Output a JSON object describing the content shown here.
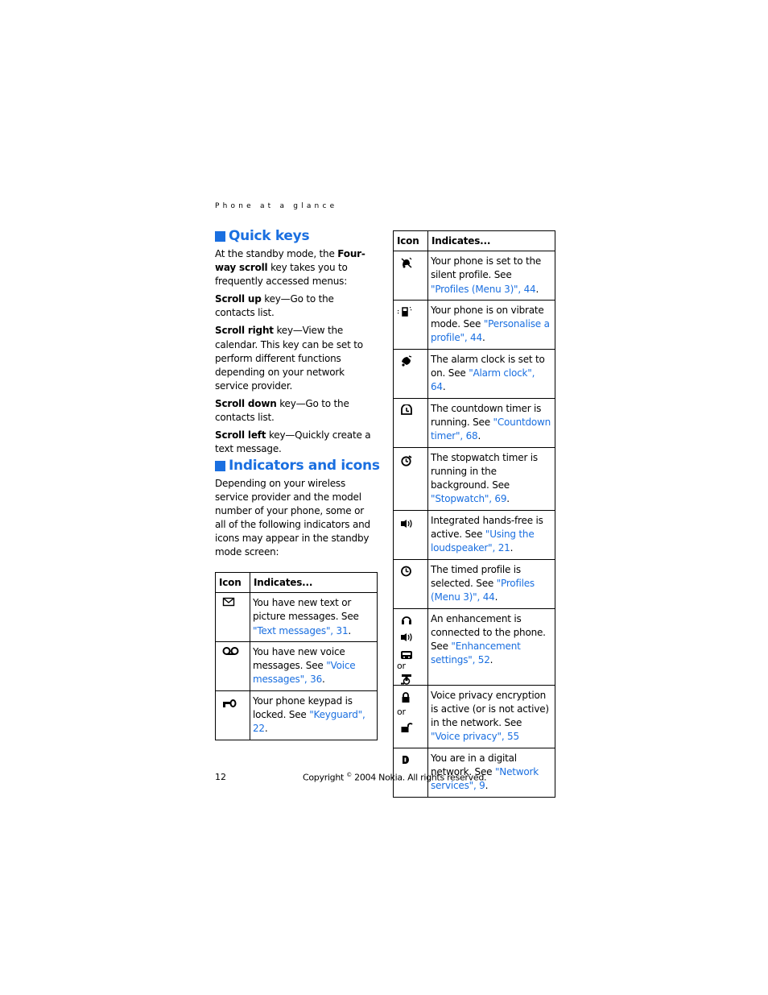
{
  "running_head": "Phone at a glance",
  "quick_keys": {
    "heading": "Quick keys",
    "intro_pre": "At the standby mode, the ",
    "intro_bold": "Four-way scroll",
    "intro_post": " key takes you to frequently accessed menus:",
    "items": [
      {
        "bold": "Scroll up",
        "text": " key—Go to the contacts list."
      },
      {
        "bold": "Scroll right",
        "text": " key—View the calendar. This key can be set to perform different functions depending on your network service provider."
      },
      {
        "bold": "Scroll down",
        "text": " key—Go to the contacts list."
      },
      {
        "bold": "Scroll left",
        "text": " key—Quickly create a text message."
      }
    ]
  },
  "indicators": {
    "heading": "Indicators and icons",
    "intro": "Depending on your wireless service provider and the model number of your phone, some or all of the following indicators and icons may appear in the standby mode screen:"
  },
  "table_headers": {
    "icon": "Icon",
    "indicates": "Indicates..."
  },
  "left_table": [
    {
      "icon": "envelope-icon",
      "text": "You have new text or picture messages. See ",
      "link": "\"Text messages\", 31",
      "end": "."
    },
    {
      "icon": "voicemail-icon",
      "text": "You have new voice messages. See ",
      "link": "\"Voice messages\", 36",
      "end": "."
    },
    {
      "icon": "key-lock-icon",
      "text": "Your phone keypad is locked. See ",
      "link": "\"Keyguard\", 22",
      "end": "."
    }
  ],
  "right_table": [
    {
      "icon": "silent-bell-icon",
      "text": "Your phone is set to the silent profile. See ",
      "link": "\"Profiles (Menu 3)\", 44",
      "end": "."
    },
    {
      "icon": "vibrate-icon",
      "text": "Your phone is on vibrate mode. See ",
      "link": "\"Personalise a profile\", 44",
      "end": "."
    },
    {
      "icon": "alarm-bell-icon",
      "text": "The alarm clock is set to on. See ",
      "link": "\"Alarm clock\", 64",
      "end": "."
    },
    {
      "icon": "countdown-timer-icon",
      "text": "The countdown timer is running. See ",
      "link": "\"Countdown timer\", 68",
      "end": "."
    },
    {
      "icon": "stopwatch-icon",
      "text": "The stopwatch timer is running in the background. See ",
      "link": "\"Stopwatch\", 69",
      "end": "."
    },
    {
      "icon": "loudspeaker-icon",
      "text": "Integrated hands-free is active. See ",
      "link": "\"Using the loudspeaker\", 21",
      "end": "."
    },
    {
      "icon": "timed-profile-clock-icon",
      "text": "The timed profile is selected. See ",
      "link": "\"Profiles (Menu 3)\", 44",
      "end": "."
    },
    {
      "icon": "enhancement-icons",
      "text": "An enhancement is connected to the phone. See ",
      "link": "\"Enhancement settings\", 52",
      "end": "."
    },
    {
      "icon": "voice-privacy-lock-icons",
      "text": "Voice privacy encryption is active (or is not active) in the network. See ",
      "link": "\"Voice privacy\", 55",
      "end": ""
    },
    {
      "icon": "digital-network-icon",
      "text": "You are in a digital network. See ",
      "link": "\"Network services\", 9",
      "end": "."
    }
  ],
  "or_label": "or",
  "footer": {
    "page_number": "12",
    "copyright_pre": "Copyright ",
    "copyright_symbol": "©",
    "copyright_post": " 2004 Nokia. All rights reserved."
  },
  "colors": {
    "accent": "#1a6fe0",
    "text": "#000000"
  }
}
